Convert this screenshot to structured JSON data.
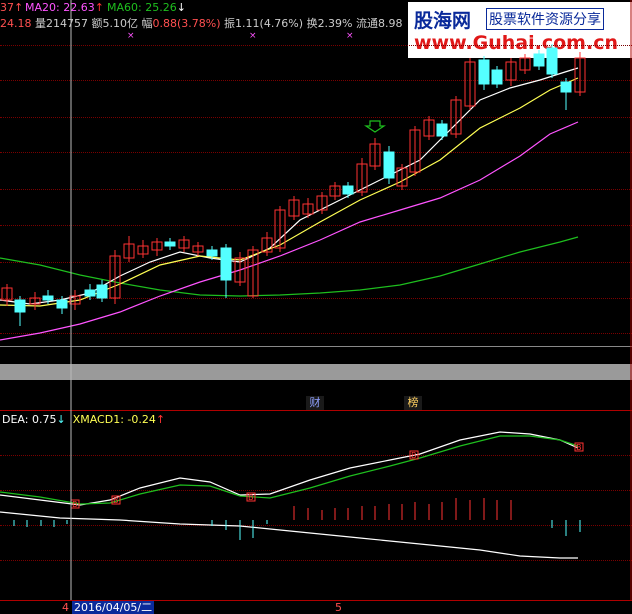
{
  "header": {
    "lead": "37",
    "lead_arrow": "↑",
    "ma20_label": "MA20:",
    "ma20_value": "22.63",
    "ma20_arrow": "↑",
    "ma60_label": "MA60:",
    "ma60_value": "25.26",
    "ma60_arrow": "↓"
  },
  "info_row": {
    "price": "24.18",
    "volume_label": "量",
    "volume_value": "214757",
    "amount_label": "额",
    "amount_value": "5.10亿",
    "change_label": "幅",
    "change_value": "0.88(3.78%)",
    "amplitude_label": "振",
    "amplitude_value": "1.11(4.76%)",
    "turnover_label": "换",
    "turnover_value": "2.39%",
    "float_label": "流通",
    "float_value": "8.98"
  },
  "watermark": {
    "brand_cn": "股海网",
    "tagline": "股票软件资源分享",
    "url": "www.Guhai.com.cn"
  },
  "markers": {
    "cai": "财",
    "bang": "榜"
  },
  "macd_header": {
    "dea_label": "DEA:",
    "dea_value": "0.75",
    "dea_arrow": "↓",
    "xmacd_label": "XMACD1:",
    "xmacd_value": "-0.24",
    "xmacd_arrow": "↑"
  },
  "signal_mark": "B",
  "bottom_bar": {
    "left_label": "4",
    "date": "2016/04/05/二",
    "month_label": "5"
  },
  "colors": {
    "up": "#ff3232",
    "down": "#54ffff",
    "ma_white": "#ffffff",
    "ma20": "#ff54ff",
    "ma60": "#1ebe1e",
    "yellow_line": "#ffff54"
  }
}
